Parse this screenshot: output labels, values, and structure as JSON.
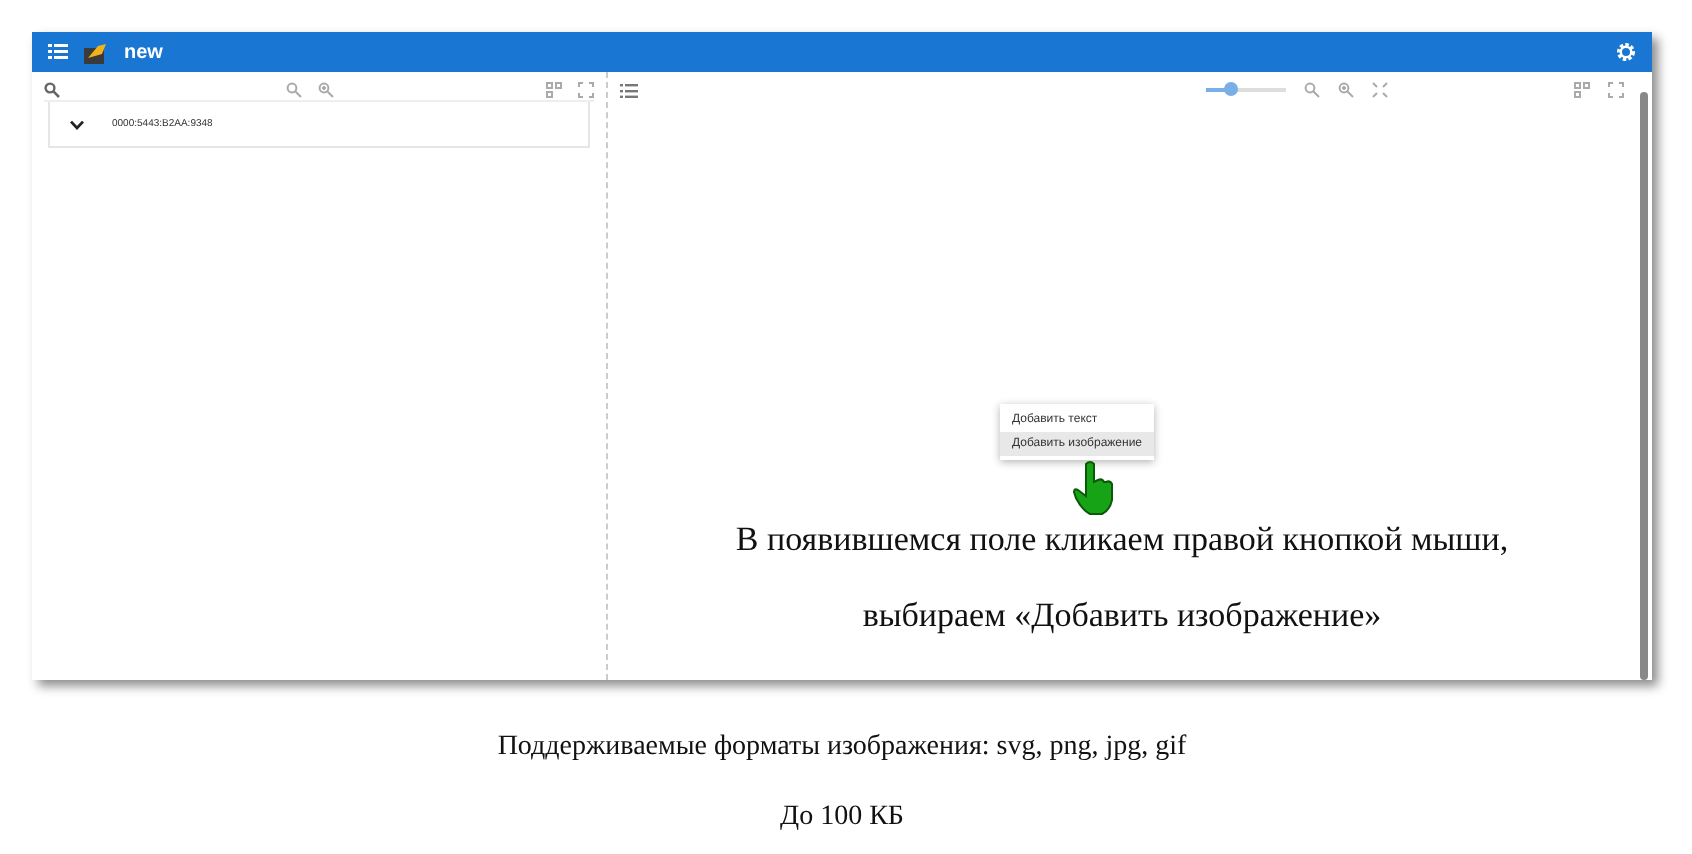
{
  "app": {
    "title": "new"
  },
  "left_panel": {
    "tree": [
      {
        "label": "0000:5443:B2AA:9348",
        "expanded": true
      }
    ]
  },
  "right_panel": {
    "zoom_slider": {
      "level": 0.3
    },
    "context_menu": [
      {
        "label": "Добавить текст",
        "selected": false
      },
      {
        "label": "Добавить изображение",
        "selected": true
      }
    ],
    "annotation": [
      "В появившемся поле кликаем правой кнопкой мыши,",
      "выбираем «Добавить изображение»"
    ]
  },
  "captions": [
    "Поддерживаемые форматы изображения: svg, png, jpg, gif",
    "До 100 КБ"
  ]
}
